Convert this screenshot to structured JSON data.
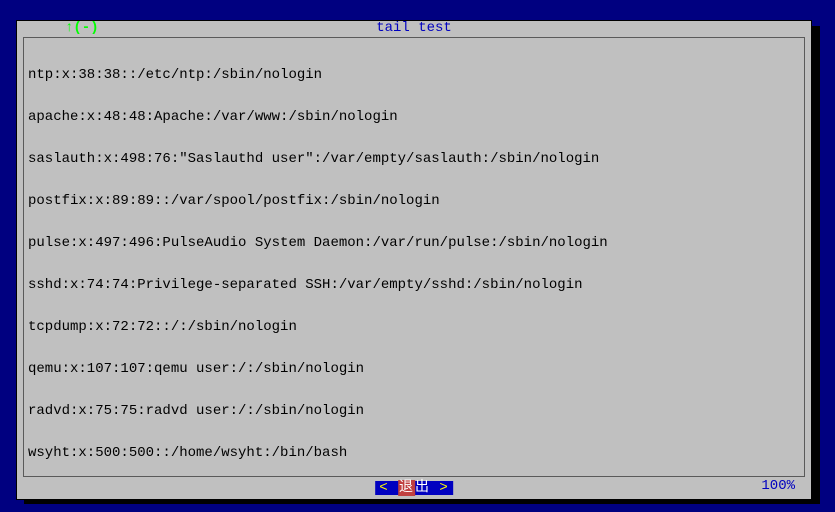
{
  "title": {
    "marker": "↑(-)",
    "text": "tail test"
  },
  "lines": [
    "ntp:x:38:38::/etc/ntp:/sbin/nologin",
    "apache:x:48:48:Apache:/var/www:/sbin/nologin",
    "saslauth:x:498:76:\"Saslauthd user\":/var/empty/saslauth:/sbin/nologin",
    "postfix:x:89:89::/var/spool/postfix:/sbin/nologin",
    "pulse:x:497:496:PulseAudio System Daemon:/var/run/pulse:/sbin/nologin",
    "sshd:x:74:74:Privilege-separated SSH:/var/empty/sshd:/sbin/nologin",
    "tcpdump:x:72:72::/:/sbin/nologin",
    "qemu:x:107:107:qemu user:/:/sbin/nologin",
    "radvd:x:75:75:radvd user:/:/sbin/nologin",
    "wsyht:x:500:500::/home/wsyht:/bin/bash"
  ],
  "footer": {
    "percent": "100%",
    "exit_lt": "<",
    "exit_label_1": "退",
    "exit_label_2": "出",
    "exit_gt": ">"
  }
}
